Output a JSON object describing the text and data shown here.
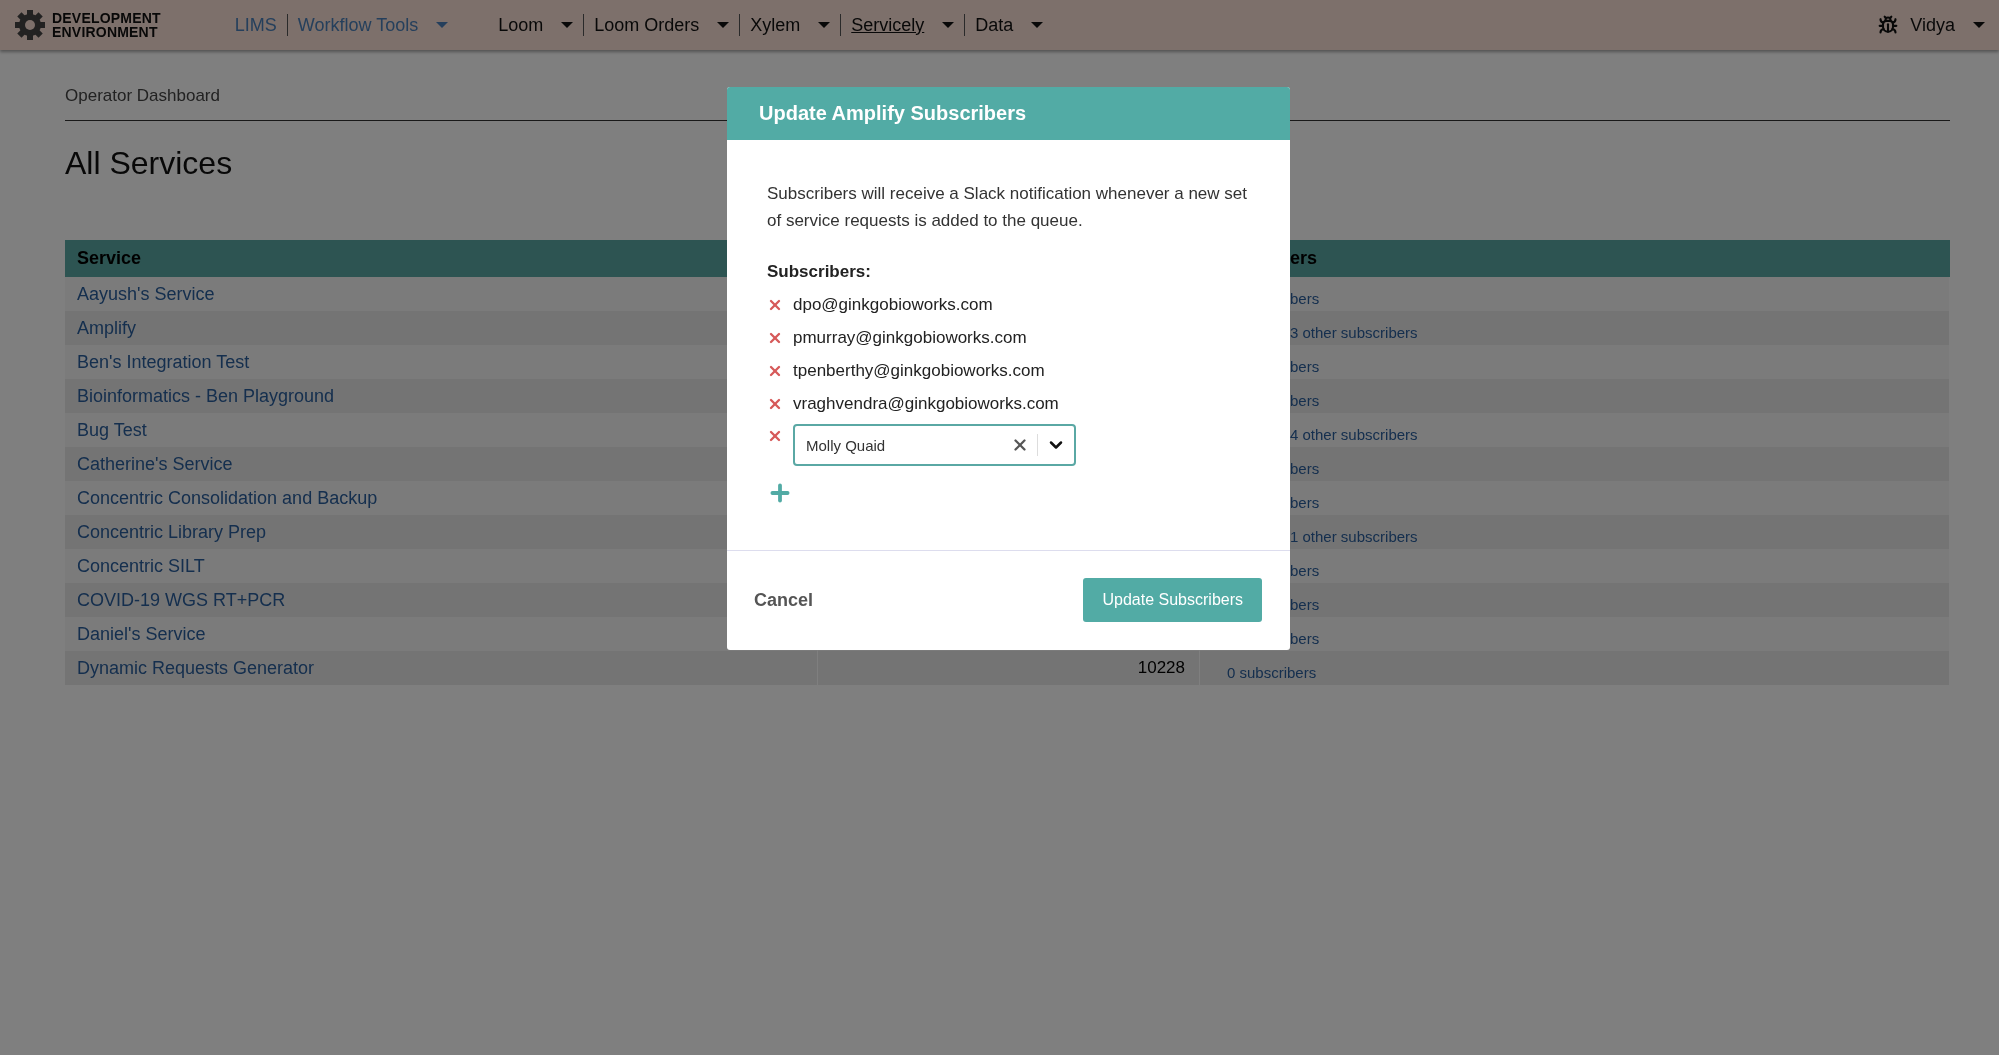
{
  "navbar": {
    "brand_lines": [
      "DEVELOPMENT",
      "ENVIRONMENT"
    ],
    "menu_groups": [
      {
        "items": [
          {
            "label": "LIMS",
            "kind": "link",
            "dropdown": false,
            "selected": false
          },
          {
            "label": "Workflow Tools",
            "kind": "link",
            "dropdown": true,
            "selected": false
          }
        ]
      },
      {
        "items": [
          {
            "label": "Loom",
            "kind": "menu",
            "dropdown": true,
            "selected": false
          },
          {
            "label": "Loom Orders",
            "kind": "menu",
            "dropdown": true,
            "selected": false
          },
          {
            "label": "Xylem",
            "kind": "menu",
            "dropdown": true,
            "selected": false
          },
          {
            "label": "Servicely",
            "kind": "menu",
            "dropdown": true,
            "selected": true
          },
          {
            "label": "Data",
            "kind": "menu",
            "dropdown": true,
            "selected": false
          }
        ]
      }
    ],
    "user": {
      "name": "Vidya"
    }
  },
  "breadcrumb": "Operator Dashboard",
  "heading": "All Services",
  "table": {
    "columns": {
      "service": "Service",
      "column_3": "ers"
    },
    "rows": [
      {
        "service": "Aayush's Service",
        "column_3": "bers",
        "cut": true
      },
      {
        "service": "Amplify",
        "column_3": "3 other subscribers",
        "cut": true
      },
      {
        "service": "Ben's Integration Test",
        "column_3": "bers",
        "cut": true
      },
      {
        "service": "Bioinformatics - Ben Playground",
        "column_3": "bers",
        "cut": true
      },
      {
        "service": "Bug Test",
        "column_3": "4 other subscribers",
        "cut": true
      },
      {
        "service": "Catherine's Service",
        "column_3": "bers",
        "cut": true
      },
      {
        "service": "Concentric Consolidation and Backup",
        "column_3": "bers",
        "cut": true
      },
      {
        "service": "Concentric Library Prep",
        "column_3": "1 other subscribers",
        "cut": true
      },
      {
        "service": "Concentric SILT",
        "column_3": "bers",
        "cut": true
      },
      {
        "service": "COVID-19 WGS RT+PCR",
        "column_3": "bers",
        "cut": true
      },
      {
        "service": "Daniel's Service",
        "column_3": "bers",
        "cut": true
      },
      {
        "service": "Dynamic Requests Generator",
        "column_2": "10228",
        "column_3": "0 subscribers",
        "cut": false
      }
    ]
  },
  "modal": {
    "title": "Update Amplify Subscribers",
    "description": "Subscribers will receive a Slack notification whenever a new set of service requests is added to the queue.",
    "subscribers_label": "Subscribers:",
    "subscribers": [
      "dpo@ginkgobioworks.com",
      "pmurray@ginkgobioworks.com",
      "tpenberthy@ginkgobioworks.com",
      "vraghvendra@ginkgobioworks.com"
    ],
    "select": {
      "value": "Molly Quaid"
    },
    "cancel": "Cancel",
    "submit": "Update Subscribers"
  }
}
